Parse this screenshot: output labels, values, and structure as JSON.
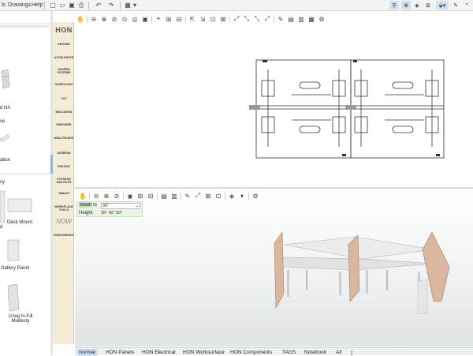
{
  "menubar": {
    "items": [
      "ls",
      "Drawings",
      "Help"
    ]
  },
  "left_panel": {
    "items": [
      {
        "label": "d HA"
      },
      {
        "label": "ve"
      },
      {
        "label": "ation"
      },
      {
        "label": "cy"
      },
      {
        "label": "d"
      },
      {
        "label": "Desk Mount"
      },
      {
        "label": "Gallery Panel"
      },
      {
        "label": "U-leg In-Fill Modesty"
      }
    ]
  },
  "hon": {
    "logo": "HON",
    "categories": [
      "AROUND",
      "ACCELERATE",
      "SHARED SYSTEMS",
      "CASEGOODS",
      "VOI",
      "EDUCATION",
      "EMPOWER",
      "HEALTHCARE",
      "SCREENS",
      "SEATING",
      "STORAGE AND PILES",
      "TABLES",
      "WORKPLACE TOOLS",
      "NOW",
      "NONCOMPANY"
    ]
  },
  "properties": {
    "width_label": "Width",
    "width_value": "30\"",
    "height_label": "Height",
    "height_options": "35\"  42\"  50\""
  },
  "tabs": [
    "Normal",
    "HON Panels",
    "HON Electrical",
    "HON Worksurface",
    "HON Components",
    "TAGS",
    "Notebook",
    "All"
  ],
  "active_tab": "Normal",
  "colors": {
    "accent": "#1e63b5",
    "hon_bg": "#f4ecd6",
    "prop_bg": "#eaf4e6",
    "panel_wood": "#d9b79f"
  }
}
